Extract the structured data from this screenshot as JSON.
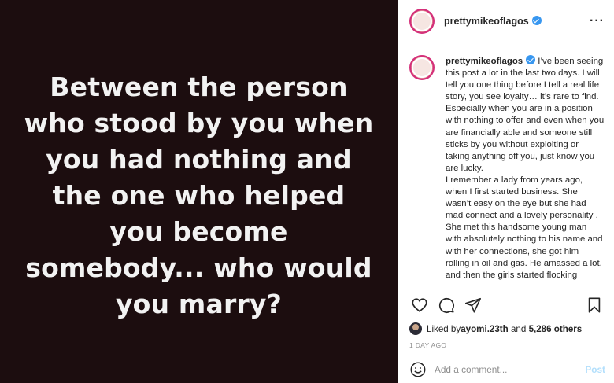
{
  "media": {
    "lines": [
      "Between the person",
      "who stood by you when",
      "you had nothing and",
      "the one who helped",
      "you become",
      "somebody... who would",
      "you marry?"
    ]
  },
  "header": {
    "username": "prettymikeoflagos",
    "more_label": "···"
  },
  "caption": {
    "username": "prettymikeoflagos",
    "paragraph1": "I’ve been seeing this post a lot in the last two days. I will tell you one thing before I tell a real life story, you see loyalty… it’s rare to find. Especially when you are in a position with nothing to offer and even when you are financially able and someone still sticks by you without exploiting or taking anything off you, just know you are lucky.",
    "paragraph2": "I remember a lady from years ago, when I first started business. She wasn’t easy on the eye but she had mad connect and a lovely personality . She met this handsome young man with absolutely nothing to his name and with her connections, she got him rolling in oil and gas. He amassed a lot, and then the girls started flocking"
  },
  "likes": {
    "prefix": "Liked by ",
    "user": "ayomi.23th",
    "middle": " and ",
    "others": "5,286 others"
  },
  "timestamp": "1 DAY AGO",
  "comment": {
    "placeholder": "Add a comment...",
    "post_label": "Post"
  },
  "icons": {
    "like": "heart-icon",
    "comment": "comment-icon",
    "share": "share-icon",
    "save": "bookmark-icon",
    "emoji": "smiley-icon",
    "verified": "verified-badge-icon"
  },
  "colors": {
    "media_bg": "#1c0d0f",
    "verified": "#3897f0",
    "post_disabled": "#b2dffc",
    "muted": "#8e8e8e"
  }
}
